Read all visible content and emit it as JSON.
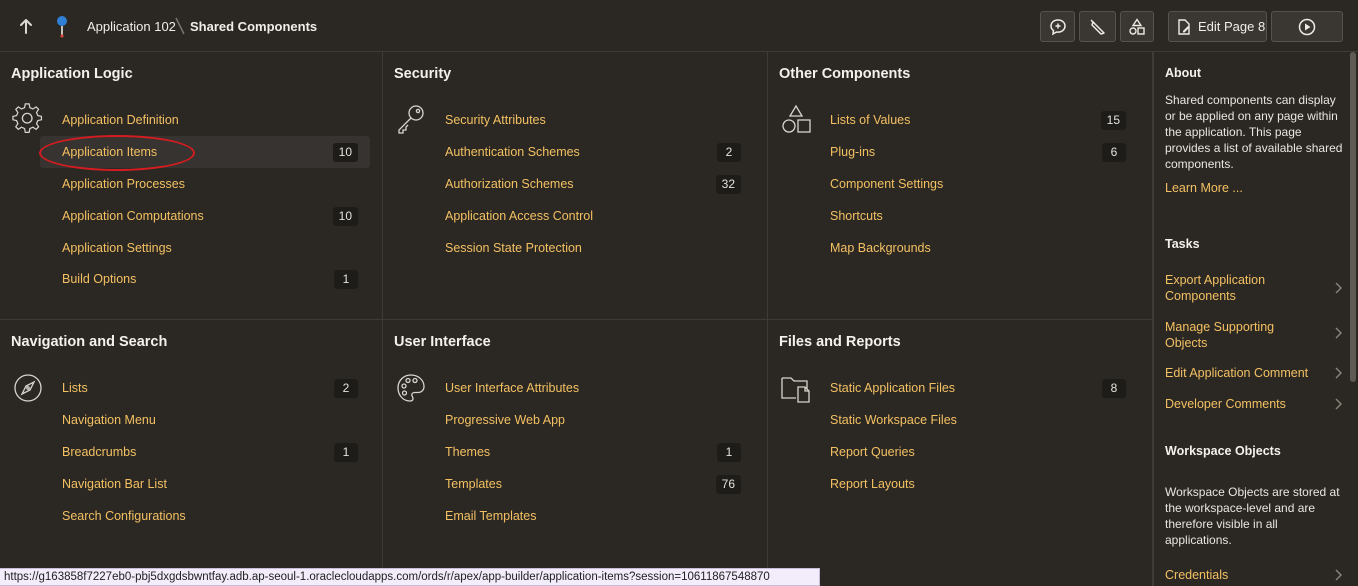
{
  "header": {
    "breadcrumb": [
      "Application 102",
      "Shared Components"
    ],
    "edit_page_label": "Edit Page 8"
  },
  "panels": {
    "application_logic": {
      "title": "Application Logic",
      "items": [
        {
          "label": "Application Definition",
          "count": ""
        },
        {
          "label": "Application Items",
          "count": "10"
        },
        {
          "label": "Application Processes",
          "count": ""
        },
        {
          "label": "Application Computations",
          "count": "10"
        },
        {
          "label": "Application Settings",
          "count": ""
        },
        {
          "label": "Build Options",
          "count": "1"
        }
      ]
    },
    "security": {
      "title": "Security",
      "items": [
        {
          "label": "Security Attributes",
          "count": ""
        },
        {
          "label": "Authentication Schemes",
          "count": "2"
        },
        {
          "label": "Authorization Schemes",
          "count": "32"
        },
        {
          "label": "Application Access Control",
          "count": ""
        },
        {
          "label": "Session State Protection",
          "count": ""
        }
      ]
    },
    "other_components": {
      "title": "Other Components",
      "items": [
        {
          "label": "Lists of Values",
          "count": "15"
        },
        {
          "label": "Plug-ins",
          "count": "6"
        },
        {
          "label": "Component Settings",
          "count": ""
        },
        {
          "label": "Shortcuts",
          "count": ""
        },
        {
          "label": "Map Backgrounds",
          "count": ""
        }
      ]
    },
    "navigation_search": {
      "title": "Navigation and Search",
      "items": [
        {
          "label": "Lists",
          "count": "2"
        },
        {
          "label": "Navigation Menu",
          "count": ""
        },
        {
          "label": "Breadcrumbs",
          "count": "1"
        },
        {
          "label": "Navigation Bar List",
          "count": ""
        },
        {
          "label": "Search Configurations",
          "count": ""
        }
      ]
    },
    "user_interface": {
      "title": "User Interface",
      "items": [
        {
          "label": "User Interface Attributes",
          "count": ""
        },
        {
          "label": "Progressive Web App",
          "count": ""
        },
        {
          "label": "Themes",
          "count": "1"
        },
        {
          "label": "Templates",
          "count": "76"
        },
        {
          "label": "Email Templates",
          "count": ""
        }
      ]
    },
    "files_reports": {
      "title": "Files and Reports",
      "items": [
        {
          "label": "Static Application Files",
          "count": "8"
        },
        {
          "label": "Static Workspace Files",
          "count": ""
        },
        {
          "label": "Report Queries",
          "count": ""
        },
        {
          "label": "Report Layouts",
          "count": ""
        }
      ]
    }
  },
  "sidebar": {
    "about_title": "About",
    "about_text": "Shared components can display or be applied on any page within the application. This page provides a list of available shared components.",
    "learn_more": "Learn More ...",
    "tasks_title": "Tasks",
    "tasks": [
      "Export Application Components",
      "Manage Supporting Objects",
      "Edit Application Comment",
      "Developer Comments"
    ],
    "workspace_title": "Workspace Objects",
    "workspace_text": "Workspace Objects are stored at the workspace-level and are therefore visible in all applications.",
    "workspace_link": "Credentials"
  },
  "status_url": "https://g163858f7227eb0-pbj5dxgdsbwntfay.adb.ap-seoul-1.oraclecloudapps.com/ords/r/apex/app-builder/application-items?session=10611867548870",
  "colors": {
    "background": "#2b2824",
    "link": "#f3c062",
    "highlight_circle": "#d51c20",
    "badge": "#1e1c19"
  },
  "icons": [
    "up-arrow-icon",
    "map-pin-icon",
    "comment-icon",
    "pen-icon",
    "shapes-icon",
    "edit-page-icon",
    "run-icon",
    "gear-icon",
    "key-icon",
    "shapes-icon",
    "compass-icon",
    "palette-icon",
    "folder-file-icon",
    "chevron-right-icon"
  ]
}
